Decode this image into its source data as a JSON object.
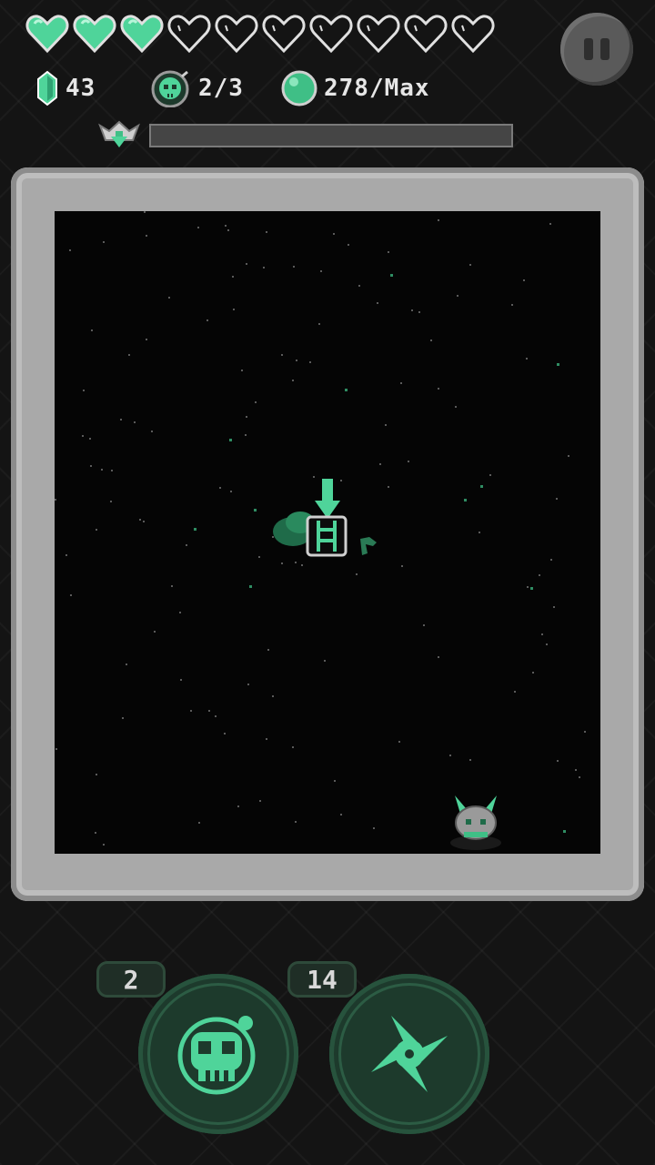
{
  "hud": {
    "hearts": [
      "full",
      "full",
      "full",
      "empty",
      "empty",
      "empty",
      "empty",
      "empty",
      "empty",
      "empty"
    ],
    "gems": "43",
    "kills": "2/3",
    "orbs": "278/Max",
    "boss_health_fraction": 0.0
  },
  "abilities": [
    {
      "name": "skull-bomb",
      "count": "2",
      "icon": "skull-icon"
    },
    {
      "name": "shuriken",
      "count": "14",
      "icon": "shuriken-icon"
    }
  ],
  "colors": {
    "accent": "#57c795",
    "heart_full": "#4fd49a",
    "heart_empty": "#141414",
    "wall": "#a9a9a9",
    "floor": "#050505",
    "button": "#1d3a2c"
  }
}
